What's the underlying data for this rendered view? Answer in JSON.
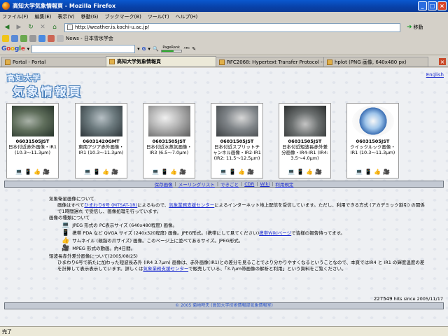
{
  "window": {
    "title": "高知大学気象情報頁 - Mozilla Firefox"
  },
  "menu": [
    "ファイル(F)",
    "編集(E)",
    "表示(V)",
    "移動(G)",
    "ブックマーク(B)",
    "ツール(T)",
    "ヘルプ(H)"
  ],
  "nav": {
    "url": "http://weather.is.kochi-u.ac.jp/",
    "go_label": "移動"
  },
  "bookmarks": {
    "label": "News - 日本雪氷学会"
  },
  "google_toolbar": {
    "logo": "Google",
    "search_value": "",
    "go_symbol": "G",
    "pagerank_label": "PageRank"
  },
  "tabs": [
    {
      "label": "Portal - Portal",
      "active": false
    },
    {
      "label": "高知大学気象情報頁",
      "active": true
    },
    {
      "label": "RFC2068: Hypertext Transfer Protocol --...",
      "active": false
    },
    {
      "label": "hplot (PNG 画像, 640x480 px)",
      "active": false
    }
  ],
  "page": {
    "logo_top": "高知大学",
    "logo_main": "気象情報頁",
    "lang_link": "English",
    "cards": [
      {
        "time": "06031505JST",
        "caption": "日本付近赤外画像・IR1 (10.3～11.3μm)",
        "thumb": "thumb-ir"
      },
      {
        "time": "06031420GMT",
        "caption": "東南アジア赤外画像・IR1 (10.3～11.3μm)",
        "thumb": "thumb-ir2"
      },
      {
        "time": "06031505JST",
        "caption": "日本付近水蒸気画像・IR3 (6.5～7.0μm)",
        "thumb": "thumb-wv"
      },
      {
        "time": "06031505JST",
        "caption": "日本付近スプリットチャンネル画像・IR2-IR1 (IR2: 11.5～12.5μm)",
        "thumb": "thumb-split"
      },
      {
        "time": "06031505JST",
        "caption": "日本付近短波長赤外差分画像・IR4-IR1 (IR4: 3.5～4.0μm)",
        "thumb": "thumb-nir"
      },
      {
        "time": "06031505JST",
        "caption": "クイックルック画像・IR1 (10.3～11.3μm)",
        "thumb": "thumb-quick"
      }
    ],
    "link_bar": [
      "保存画像",
      "メーリングリスト",
      "できごと",
      "CDR",
      "Wiki",
      "利用規定"
    ],
    "text": {
      "h1": "気象衛星画像について",
      "p1a": "画像はすべて",
      "p1_link1": "ひまわり6号 (MTSAT-1R)",
      "p1b": "によるもので、",
      "p1_link2": "気象業務支援センター",
      "p1c": "によるインターネット地上配信を受信しています。ただし、利用できる方式 (アカデミック割引) の関係で1時間遅れ で受信し、画像処理を行っています。",
      "h2": "画像の種類について",
      "i1": "JPEG 形式の PC表示サイズ (640x480程度) 画像。",
      "i2a": "携帯 PDA など QVGA サイズ (240x320程度) 画像。JPEG形式。(携帯にして見てください)",
      "i2_link": "携帯Wikiページ",
      "i2b": "で皆様の報告待ってます。",
      "i3": "サムネイル (親指の爪サイズ) 画像。このページ上に並べてあるサイズ。JPEG形式。",
      "i4": "MPEG 形式の動画。約4日間。",
      "h3": "短波長赤外差分画像について(2005/08/25)",
      "p3a": "ひまわり6号で新たに加わった短波長赤外 (IR4 3.7μm) 画像は、赤外画像(IR1)との差分を見ることでより分かりやすくなるということなので、本頁ではIR4 と IR1 の輝度温度の差を計算して表示表示しています。詳しくは",
      "p3_link": "気象業務支援センター",
      "p3b": "で販売している、「3.7μm帯画像の解析と利用」という資料をご覧ください。"
    },
    "counter": {
      "value": "227549",
      "label": "hits since 2005/11/17"
    },
    "footer": "© 2005 菊地時夫 (高知大学技術情報部気象情報室)"
  },
  "status": {
    "text": "完了"
  }
}
